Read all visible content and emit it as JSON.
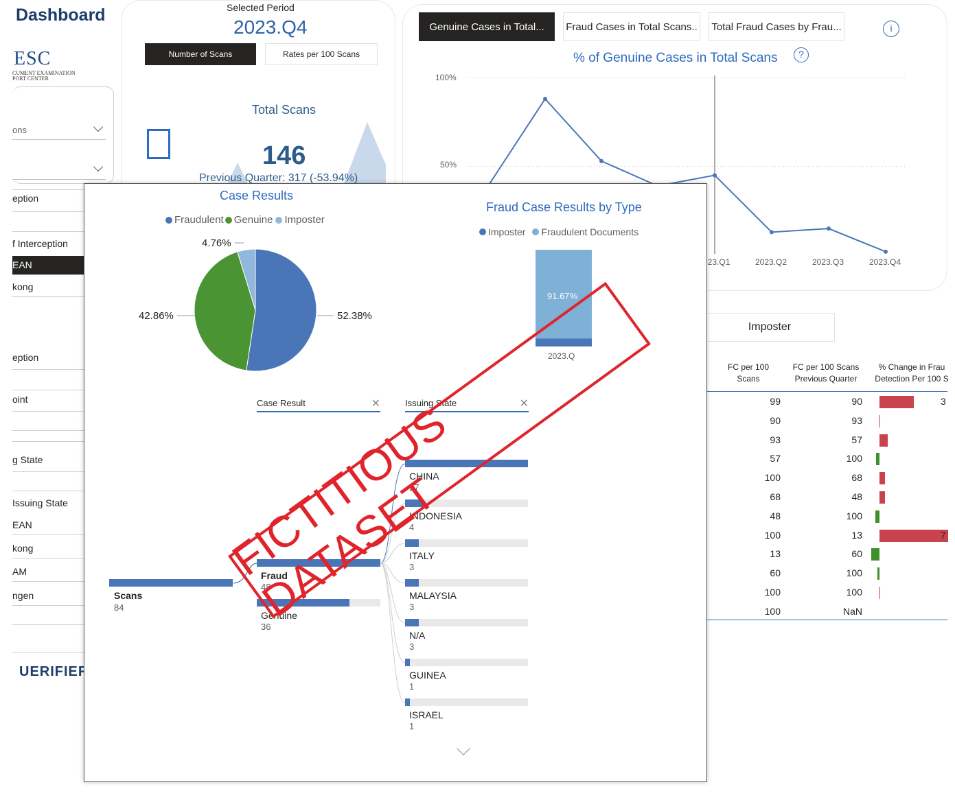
{
  "dashboard": {
    "title": "Dashboard",
    "logo": {
      "text": "ESC",
      "subtitle_line1": "CUMENT EXAMINATION",
      "subtitle_line2": "PORT CENTER"
    },
    "footer_logo": "UERIFIER",
    "sidebar": {
      "dropdown1": "ons",
      "dropdown2": "",
      "labels": [
        "eption",
        "f Interception",
        "eption",
        "oint",
        "g State",
        "Issuing State"
      ],
      "fields": [
        "EAN",
        "kong",
        "EAN",
        "kong",
        "AM",
        "ngen"
      ]
    }
  },
  "period": {
    "label": "Selected Period",
    "value": "2023.Q4",
    "tabs": [
      {
        "label": "Number of Scans",
        "active": true
      },
      {
        "label": "Rates per 100 Scans",
        "active": false
      }
    ],
    "total_title": "Total Scans",
    "total_value": "146",
    "previous_quarter": "Previous Quarter: 317 (-53.94%)"
  },
  "trend": {
    "tabs": [
      {
        "label": "Genuine Cases in Total...",
        "active": true
      },
      {
        "label": "Fraud Cases in Total Scans..",
        "active": false
      },
      {
        "label": "Total Fraud Cases by Frau...",
        "active": false
      }
    ],
    "info_icon": "info-icon",
    "help_icon": "help-icon",
    "title": "% of Genuine Cases in Total Scans",
    "y_ticks": [
      "100%",
      "50%"
    ],
    "x_ticks": [
      "023.Q1",
      "2023.Q2",
      "2023.Q3",
      "2023.Q4"
    ]
  },
  "table": {
    "filter_button": "Imposter",
    "headers": [
      "FC per 100\nScans",
      "FC per 100 Scans\nPrevious Quarter",
      "% Change in Frau\nDetection Per 100 S"
    ],
    "rows": [
      {
        "fc": "99",
        "prev": "90",
        "dir": "up",
        "mag": 0.62,
        "tail": "3"
      },
      {
        "fc": "90",
        "prev": "93",
        "dir": "none",
        "mag": 0.0,
        "tail": ""
      },
      {
        "fc": "93",
        "prev": "57",
        "dir": "up",
        "mag": 0.15,
        "tail": ""
      },
      {
        "fc": "57",
        "prev": "100",
        "dir": "down",
        "mag": 0.06,
        "tail": ""
      },
      {
        "fc": "100",
        "prev": "68",
        "dir": "up",
        "mag": 0.1,
        "tail": ""
      },
      {
        "fc": "68",
        "prev": "48",
        "dir": "up",
        "mag": 0.1,
        "tail": ""
      },
      {
        "fc": "48",
        "prev": "100",
        "dir": "down",
        "mag": 0.07,
        "tail": ""
      },
      {
        "fc": "100",
        "prev": "13",
        "dir": "up",
        "mag": 1.25,
        "tail": "7"
      },
      {
        "fc": "13",
        "prev": "60",
        "dir": "down",
        "mag": 0.15,
        "tail": ""
      },
      {
        "fc": "60",
        "prev": "100",
        "dir": "down",
        "mag": 0.04,
        "tail": ""
      },
      {
        "fc": "100",
        "prev": "100",
        "dir": "none",
        "mag": 0.0,
        "tail": ""
      },
      {
        "fc": "100",
        "prev": "NaN",
        "dir": "none",
        "mag": 0.0,
        "tail": ""
      }
    ]
  },
  "popup": {
    "case_results": {
      "title": "Case Results",
      "legend": [
        {
          "name": "Fraudulent",
          "color": "#4a76b8"
        },
        {
          "name": "Genuine",
          "color": "#4a9433"
        },
        {
          "name": "Imposter",
          "color": "#8fb8dc"
        }
      ]
    },
    "fraud_type": {
      "title": "Fraud Case Results by Type",
      "legend": [
        {
          "name": "Imposter",
          "color": "#4a76b8"
        },
        {
          "name": "Fraudulent Documents",
          "color": "#7fb0d6"
        }
      ],
      "bar_label": "91.67%",
      "x_label": "2023.Q"
    },
    "filters": [
      {
        "label": "Case Result",
        "close_icon": "close-icon"
      },
      {
        "label": "Issuing State",
        "close_icon": "close-icon"
      }
    ],
    "tree": {
      "root": {
        "name": "Scans",
        "count": "84"
      },
      "level1": [
        {
          "name": "Fraud",
          "count": "48",
          "fill": 1.0,
          "bold": true
        },
        {
          "name": "Genuine",
          "count": "36",
          "fill": 0.75,
          "bold": false
        }
      ],
      "level2": [
        {
          "name": "CHINA",
          "count": "27",
          "fill": 1.0
        },
        {
          "name": "INDONESIA",
          "count": "4",
          "fill": 0.15
        },
        {
          "name": "ITALY",
          "count": "3",
          "fill": 0.11
        },
        {
          "name": "MALAYSIA",
          "count": "3",
          "fill": 0.11
        },
        {
          "name": "N/A",
          "count": "3",
          "fill": 0.11
        },
        {
          "name": "GUINEA",
          "count": "1",
          "fill": 0.04
        },
        {
          "name": "ISRAEL",
          "count": "1",
          "fill": 0.04
        }
      ],
      "expand_icon": "chevron-down-icon"
    }
  },
  "watermark": "FICTITIOUS DATASET",
  "chart_data": [
    {
      "type": "line",
      "title": "% of Genuine Cases in Total Scans",
      "x": [
        "",
        "",
        "",
        "",
        "023.Q1",
        "2023.Q2",
        "2023.Q3",
        "2023.Q4"
      ],
      "series": [
        {
          "values": [
            39,
            88,
            53,
            39,
            45,
            13,
            15,
            2
          ]
        }
      ],
      "ylim": [
        0,
        100
      ],
      "y_ticks": [
        "100%",
        "50%"
      ],
      "grid": true
    },
    {
      "type": "pie",
      "title": "Case Results",
      "categories": [
        "Fraudulent",
        "Genuine",
        "Imposter"
      ],
      "values": [
        52.38,
        42.86,
        4.76
      ],
      "labels": [
        "52.38%",
        "42.86%",
        "4.76%"
      ],
      "legend": "top"
    },
    {
      "type": "bar",
      "title": "Fraud Case Results by Type",
      "categories": [
        "2023.Q"
      ],
      "series": [
        {
          "name": "Imposter",
          "values": [
            8.33
          ]
        },
        {
          "name": "Fraudulent Documents",
          "values": [
            91.67
          ]
        }
      ],
      "stacked": true,
      "legend": "top"
    }
  ]
}
